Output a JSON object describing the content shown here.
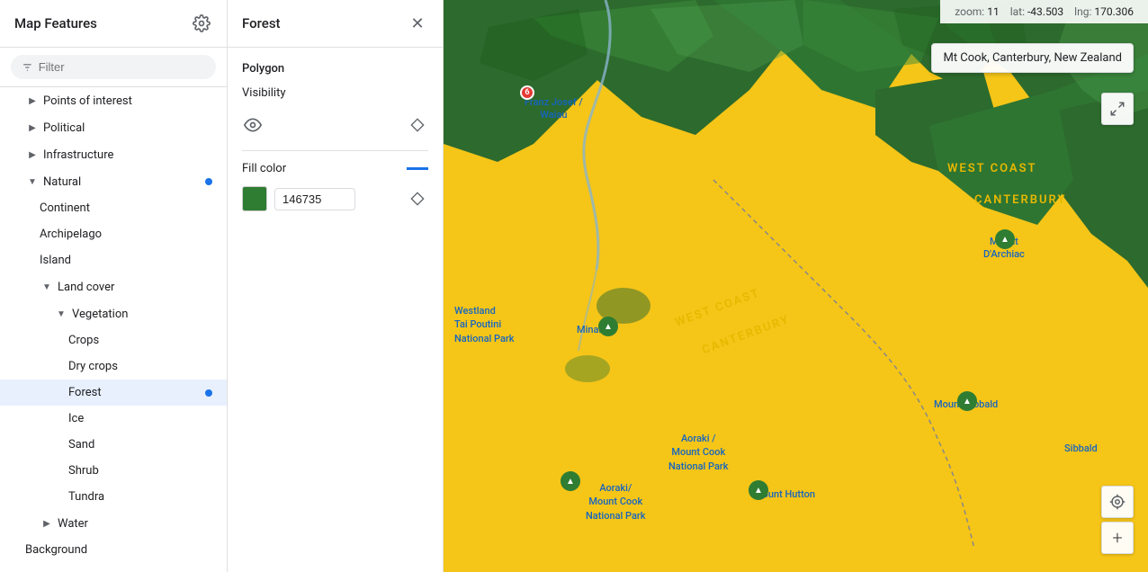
{
  "left_panel": {
    "title": "Map Features",
    "filter_placeholder": "Filter",
    "items": [
      {
        "id": "points-of-interest",
        "label": "Points of interest",
        "indent": 1,
        "has_chevron": true,
        "chevron_dir": "right"
      },
      {
        "id": "political",
        "label": "Political",
        "indent": 1,
        "has_chevron": true,
        "chevron_dir": "right"
      },
      {
        "id": "infrastructure",
        "label": "Infrastructure",
        "indent": 1,
        "has_chevron": true,
        "chevron_dir": "right"
      },
      {
        "id": "natural",
        "label": "Natural",
        "indent": 1,
        "has_chevron": true,
        "chevron_dir": "down",
        "has_dot": true
      },
      {
        "id": "continent",
        "label": "Continent",
        "indent": 2
      },
      {
        "id": "archipelago",
        "label": "Archipelago",
        "indent": 2
      },
      {
        "id": "island",
        "label": "Island",
        "indent": 2
      },
      {
        "id": "land-cover",
        "label": "Land cover",
        "indent": 2,
        "has_chevron": true,
        "chevron_dir": "down"
      },
      {
        "id": "vegetation",
        "label": "Vegetation",
        "indent": 3,
        "has_chevron": true,
        "chevron_dir": "down"
      },
      {
        "id": "crops",
        "label": "Crops",
        "indent": 4
      },
      {
        "id": "dry-crops",
        "label": "Dry crops",
        "indent": 4
      },
      {
        "id": "forest",
        "label": "Forest",
        "indent": 4,
        "active": true,
        "has_dot": true
      },
      {
        "id": "ice",
        "label": "Ice",
        "indent": 4
      },
      {
        "id": "sand",
        "label": "Sand",
        "indent": 4
      },
      {
        "id": "shrub",
        "label": "Shrub",
        "indent": 4
      },
      {
        "id": "tundra",
        "label": "Tundra",
        "indent": 4
      },
      {
        "id": "water",
        "label": "Water",
        "indent": 2,
        "has_chevron": true,
        "chevron_dir": "right"
      },
      {
        "id": "background",
        "label": "Background",
        "indent": 1
      }
    ]
  },
  "middle_panel": {
    "title": "Forest",
    "polygon_label": "Polygon",
    "visibility_label": "Visibility",
    "fill_color_label": "Fill color",
    "color_hex": "146735",
    "color_value": "#2e7d32"
  },
  "map": {
    "zoom_label": "zoom:",
    "zoom_value": "11",
    "lat_label": "lat:",
    "lat_value": "-43.503",
    "lng_label": "lng:",
    "lng_value": "170.306",
    "location_tooltip": "Mt Cook, Canterbury, New Zealand",
    "labels": [
      {
        "text": "WEST COAST",
        "top": "175",
        "left": "560"
      },
      {
        "text": "CANTERBURY",
        "top": "215",
        "left": "590"
      },
      {
        "text": "WEST COAST",
        "top": "325",
        "left": "265"
      },
      {
        "text": "CANTERBURY",
        "top": "365",
        "left": "280"
      }
    ],
    "places": [
      {
        "text": "Franz Josef / Waiau",
        "top": "105",
        "left": "75"
      },
      {
        "text": "Mount D'Archiac",
        "top": "265",
        "left": "615"
      },
      {
        "text": "Westland\nTai Poutini\nNational Park",
        "top": "340",
        "left": "10"
      },
      {
        "text": "Minarets",
        "top": "360",
        "left": "145"
      },
      {
        "text": "Mount Sibbald",
        "top": "445",
        "left": "540"
      },
      {
        "text": "Aoraki /\nMount Cook\nNational Park",
        "top": "480",
        "left": "250"
      },
      {
        "text": "Aoraki/\nMount Cook\nNational Park",
        "top": "540",
        "left": "155"
      },
      {
        "text": "Mount Hutton",
        "top": "543",
        "left": "340"
      },
      {
        "text": "Sibbald",
        "top": "495",
        "left": "680"
      }
    ]
  }
}
